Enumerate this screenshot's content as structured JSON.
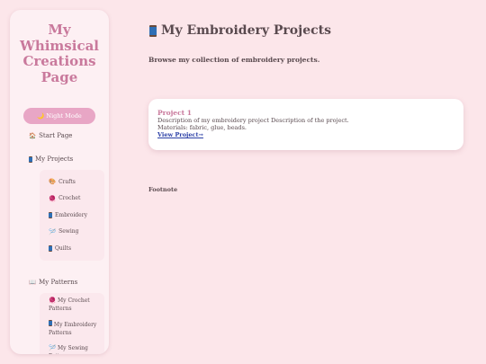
{
  "sidebar": {
    "title": "My Whimsical Creations Page",
    "night_mode_label": "🌙 Night Mode",
    "start_page": {
      "icon": "🏠",
      "label": "Start Page"
    },
    "projects": {
      "icon": "spool-icon",
      "label": "My Projects",
      "items": [
        {
          "icon": "🎨",
          "label": "Crafts"
        },
        {
          "icon": "🧶",
          "label": "Crochet"
        },
        {
          "icon": "spool-icon",
          "label": "Embroidery"
        },
        {
          "icon": "🪡",
          "label": "Sewing"
        },
        {
          "icon": "spool-icon",
          "label": "Quilts"
        }
      ]
    },
    "patterns": {
      "icon": "📖",
      "label": "My Patterns",
      "items": [
        {
          "icon": "🧶",
          "label": "My Crochet Patterns"
        },
        {
          "icon": "spool-icon",
          "label": "My Embroidery Patterns"
        },
        {
          "icon": "🪡",
          "label": "My Sewing Patterns"
        }
      ]
    }
  },
  "main": {
    "title": "My Embroidery Projects",
    "subtitle": "Browse my collection of embroidery projects.",
    "card": {
      "title": "Project 1",
      "image_alt": "Description of my embroidery project",
      "description": "Description of the project.",
      "materials": "Materials: fabric, glue, beads.",
      "link": "View Project→"
    },
    "footnote": "Footnote"
  },
  "colors": {
    "background": "#fce6ea",
    "sidebar": "#fdf0f3",
    "accent": "#c9799c",
    "button": "#e8a6c5",
    "link": "#2a3fa6"
  }
}
